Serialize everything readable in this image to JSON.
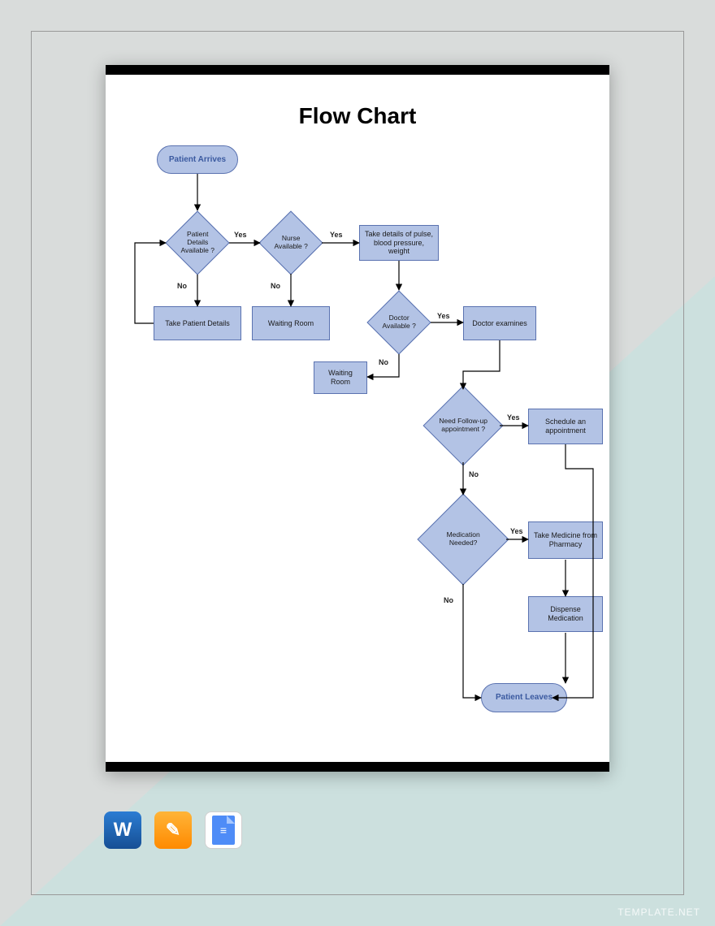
{
  "page": {
    "title": "Flow Chart"
  },
  "nodes": {
    "start": "Patient Arrives",
    "d1": "Patient Details Available ?",
    "p1": "Take Patient Details",
    "d2": "Nurse Available ?",
    "p2": "Waiting Room",
    "p3": "Take details of pulse, blood pressure, weight",
    "d3": "Doctor Available ?",
    "p4": "Waiting Room",
    "p5": "Doctor examines",
    "d4": "Need Follow-up appointment ?",
    "p6": "Schedule an appointment",
    "d5": "Medication Needed?",
    "p7": "Take Medicine from Pharmacy",
    "p8": "Dispense Medication",
    "end": "Patient Leaves"
  },
  "labels": {
    "yes": "Yes",
    "no": "No"
  },
  "icons": {
    "word": "W",
    "pages": "✎",
    "gdocs": "≡"
  },
  "watermark": {
    "brand": "TEMPLATE",
    "tld": ".NET"
  }
}
